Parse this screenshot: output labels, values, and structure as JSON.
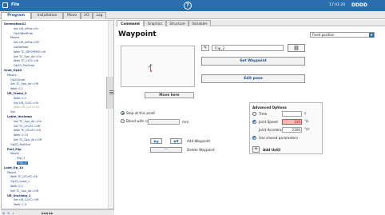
{
  "topbar": {
    "file_label": "File",
    "clock": "17:41:20",
    "robot": "DDDD",
    "help_glyph": "?"
  },
  "main_tabs": [
    "Program",
    "Installation",
    "Move",
    "I/O",
    "Log"
  ],
  "tree": {
    "items": [
      {
        "text": "GenerationS1",
        "indent": 0,
        "kind": "top"
      },
      {
        "text": "Set UR_InPos=On",
        "indent": 3
      },
      {
        "text": "Op10NotProb",
        "indent": 3
      },
      {
        "text": "MoveL",
        "indent": 2
      },
      {
        "text": "Set UR_InPos=Off",
        "indent": 3
      },
      {
        "text": "LatheDoor",
        "indent": 3
      },
      {
        "text": "Wait TC_DROPENO=Hi",
        "indent": 3
      },
      {
        "text": "Set TC_Spn_Air=On",
        "indent": 3
      },
      {
        "text": "Wait TC_CLFC=Hi",
        "indent": 3
      },
      {
        "text": "Op20_PreGrab",
        "indent": 3
      },
      {
        "text": "Grab_Op20",
        "indent": 0,
        "kind": "bold"
      },
      {
        "text": "MoveL",
        "indent": 1
      },
      {
        "text": "Op20Grab",
        "indent": 2
      },
      {
        "text": "Set TC_Spn_Air=Off",
        "indent": 2
      },
      {
        "text": "Wait: 0.1",
        "indent": 2
      },
      {
        "text": "UR_Clamp_2",
        "indent": 1,
        "kind": "bold"
      },
      {
        "text": "Wait: 0.1",
        "indent": 3
      },
      {
        "text": "Set UR_CLFC=On",
        "indent": 3
      },
      {
        "text": "Wait UR_CLFC=Hi",
        "indent": 3,
        "kind": "gray"
      },
      {
        "text": "Set",
        "indent": 2
      },
      {
        "text": "Lathe_Unclamp",
        "indent": 1,
        "kind": "bold"
      },
      {
        "text": "Set TC_Spn_Air=On",
        "indent": 3
      },
      {
        "text": "Set TC_UCLFC=Off",
        "indent": 3
      },
      {
        "text": "Wait TC_UCLFC=Hi",
        "indent": 3
      },
      {
        "text": "Wait: 0.15",
        "indent": 3
      },
      {
        "text": "Set TC_Spn_Air=Off",
        "indent": 3
      },
      {
        "text": "Op20_PartPull",
        "indent": 2
      },
      {
        "text": "Part_Flip",
        "indent": 1,
        "kind": "bold"
      },
      {
        "text": "MoveJ",
        "indent": 2
      },
      {
        "text": "Flip_1",
        "indent": 4
      },
      {
        "text": "Flip_2",
        "indent": 4,
        "kind": "sel"
      },
      {
        "text": "Load_Op_10",
        "indent": 0,
        "kind": "bold"
      },
      {
        "text": "MoveL",
        "indent": 1
      },
      {
        "text": "Wait TC_UCLPC=Hi",
        "indent": 2
      },
      {
        "text": "Op10_Load_1",
        "indent": 2
      },
      {
        "text": "Wait: 0.1",
        "indent": 2
      },
      {
        "text": "Set TC_Spn_Air=Off",
        "indent": 2
      },
      {
        "text": "UR_Unclamp_1",
        "indent": 1,
        "kind": "bold"
      },
      {
        "text": "Set UR_CLFC=Off",
        "indent": 3
      },
      {
        "text": "Wait: 1.0",
        "indent": 3
      }
    ]
  },
  "treebar": {
    "mid_label": "◀◀◀ ▶▶"
  },
  "pane_tabs": [
    "Command",
    "Graphics",
    "Structure",
    "Variables"
  ],
  "waypoint": {
    "title": "Waypoint",
    "position_mode": "Fixed position",
    "name": "Flip_2",
    "set_waypoint": "Set Waypoint",
    "edit_pose": "Edit pose",
    "move_here": "Move here",
    "stop_label": "Stop at this point",
    "blend_label": "Blend with radius",
    "blend_unit": "mm",
    "add_waypoint": "Add Waypoint",
    "delete_waypoint": "Delete Waypoint"
  },
  "advanced": {
    "title": "Advanced Options",
    "time_label": "Time",
    "time_unit": "s",
    "speed_label": "Joint Speed",
    "speed_value": "130",
    "speed_unit": "°/s",
    "accel_label": "Joint Acceleration",
    "accel_value": "2100",
    "accel_unit": "°/s²",
    "shared_label": "Use shared parameters",
    "add_until": "Add Until"
  }
}
